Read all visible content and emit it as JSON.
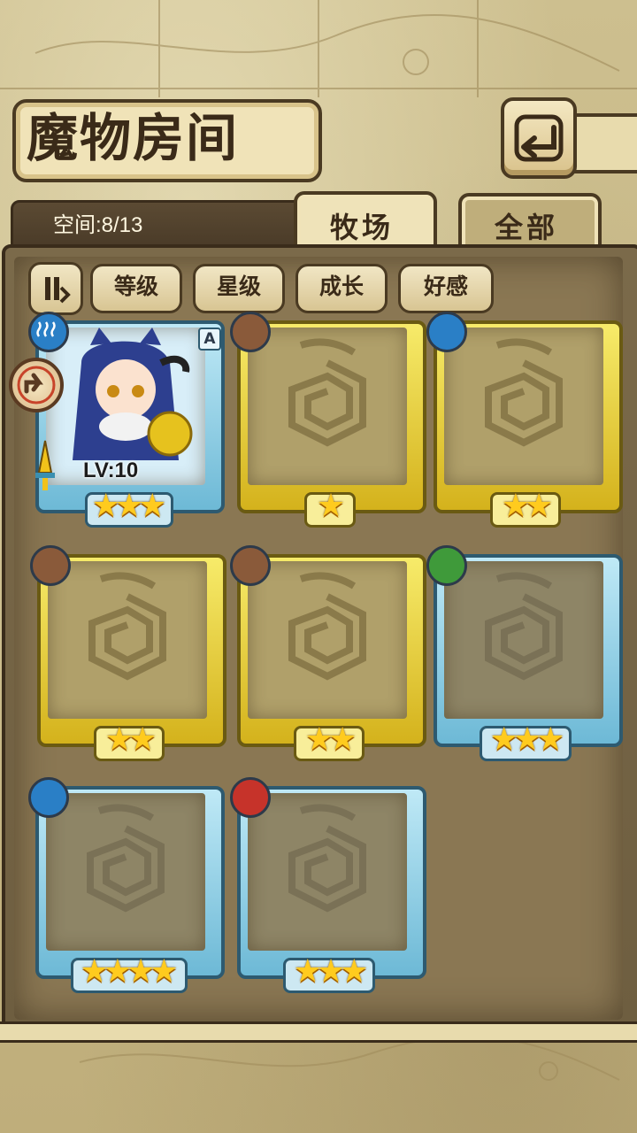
{
  "title": "魔物房间",
  "space": "空间:8/13",
  "tabs": [
    {
      "label": "牧场",
      "active": true
    },
    {
      "label": "全部",
      "active": false
    }
  ],
  "filters": [
    "等级",
    "星级",
    "成长",
    "好感"
  ],
  "cards": [
    {
      "frame": "blue",
      "element": "water",
      "stars": 3,
      "level": "LV:10",
      "rank": "A",
      "revealed": true
    },
    {
      "frame": "gold",
      "element": "earth",
      "stars": 1,
      "revealed": false
    },
    {
      "frame": "gold",
      "element": "water",
      "stars": 2,
      "revealed": false
    },
    {
      "frame": "gold",
      "element": "earth",
      "stars": 2,
      "revealed": false
    },
    {
      "frame": "gold",
      "element": "earth",
      "stars": 2,
      "revealed": false
    },
    {
      "frame": "blue",
      "element": "wood",
      "stars": 3,
      "revealed": false
    },
    {
      "frame": "blue",
      "element": "water",
      "stars": 4,
      "revealed": false
    },
    {
      "frame": "blue",
      "element": "fire",
      "stars": 3,
      "revealed": false
    }
  ],
  "colors": {
    "water": "#2a7fc6",
    "earth": "#8a5a3a",
    "wood": "#3f9a3a",
    "fire": "#c6332a",
    "star": "#ffcb1e"
  },
  "icons": {
    "back": "back-arrow-icon",
    "sort": "sort-toggle-icon",
    "leader": "leader-badge-icon"
  }
}
